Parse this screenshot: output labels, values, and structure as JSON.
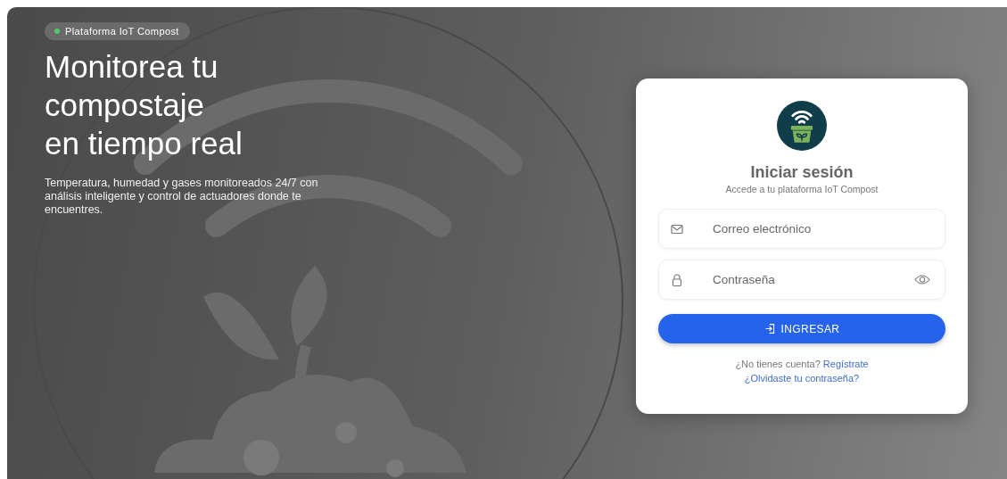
{
  "hero": {
    "badge": "Plataforma IoT Compost",
    "heading": [
      "Monitorea tu",
      "compostaje",
      "en tiempo real"
    ],
    "description": "Temperatura, humedad y gases monitoreados 24/7 con análisis inteligente y control de actuadores donde te encuentres."
  },
  "login": {
    "title": "Iniciar sesión",
    "subtitle": "Accede a tu plataforma IoT Compost",
    "fields": [
      {
        "kind": "email",
        "placeholder": "Correo electrónico"
      },
      {
        "kind": "password",
        "placeholder": "Contraseña"
      }
    ],
    "submit": "INGRESAR",
    "signup_prompt": "¿No tienes cuenta?",
    "signup_link": "Regístrate",
    "forgot_link": "¿Olvidaste tu contraseña?"
  }
}
